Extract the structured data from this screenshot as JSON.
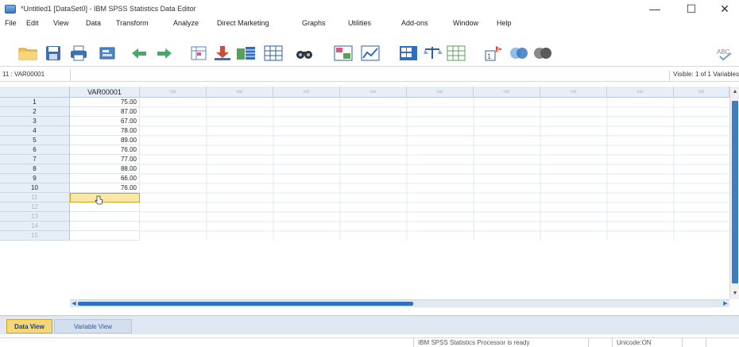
{
  "window": {
    "title": "*Untitled1 [DataSet0] - IBM SPSS Statistics Data Editor",
    "minimize_glyph": "—",
    "maximize_glyph": "☐",
    "close_glyph": "✕"
  },
  "menu": [
    "File",
    "Edit",
    "View",
    "Data",
    "Transform",
    "Analyze",
    "Direct Marketing",
    "Graphs",
    "Utilities",
    "Add-ons",
    "Window",
    "Help"
  ],
  "toolbar": {
    "icons": [
      "open-folder-icon",
      "save-icon",
      "print-icon",
      "dialog-recall-icon",
      "undo-icon",
      "redo-icon",
      "goto-case-icon",
      "goto-variable-icon",
      "variables-icon",
      "run-descriptives-icon",
      "find-icon",
      "insert-cases-icon",
      "insert-variable-icon",
      "split-file-icon",
      "weight-cases-icon",
      "select-cases-icon",
      "value-labels-icon",
      "use-sets-icon",
      "show-all-variables-icon",
      "spelling-icon"
    ]
  },
  "editor": {
    "cell_reference": "11 : VAR00001",
    "visible_count": "Visible: 1 of 1 Variables"
  },
  "grid": {
    "column_headers": [
      "VAR00001",
      "var",
      "var",
      "var",
      "var",
      "var",
      "var",
      "var",
      "var",
      "var"
    ],
    "row_numbers": [
      "1",
      "2",
      "3",
      "4",
      "5",
      "6",
      "7",
      "8",
      "9",
      "10",
      "11",
      "12",
      "13",
      "14",
      "15"
    ],
    "var00001_values": [
      "75.00",
      "87.00",
      "67.00",
      "78.00",
      "89.00",
      "76.00",
      "77.00",
      "88.00",
      "66.00",
      "76.00"
    ],
    "active_row": "11"
  },
  "tabs": {
    "data_view": "Data View",
    "variable_view": "Variable View"
  },
  "status": {
    "processor": "IBM SPSS Statistics Processor is ready",
    "unicode": "Unicode:ON"
  },
  "colors": {
    "accent": "#2d6fc2",
    "active_cell": "#fbe8a6",
    "header_bg": "#e6eef8"
  }
}
